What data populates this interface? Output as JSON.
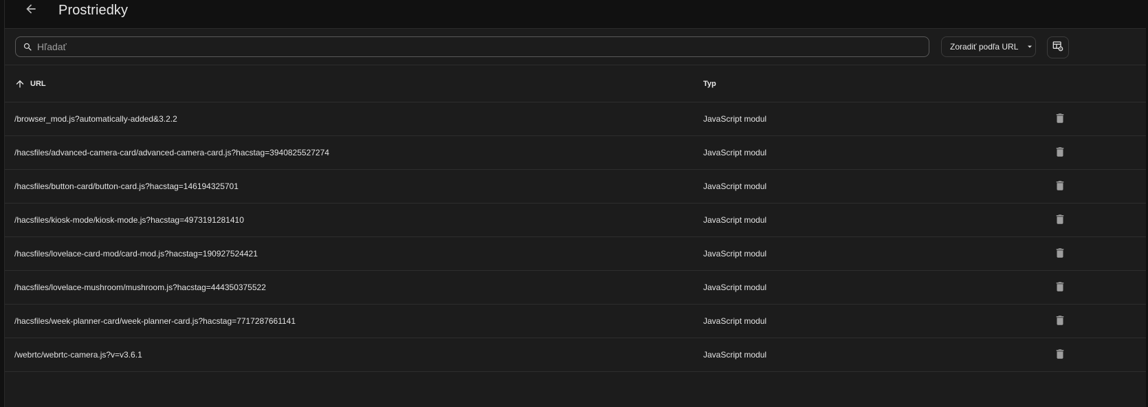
{
  "toolbar": {
    "title": "Prostriedky",
    "back_icon": "arrow-left-icon"
  },
  "search": {
    "placeholder": "Hľadať",
    "value": "",
    "icon": "search-icon"
  },
  "sort": {
    "label": "Zoradiť podľa URL",
    "icon": "caret-down-icon"
  },
  "settings": {
    "icon": "table-settings-icon"
  },
  "table": {
    "columns": {
      "url": "URL",
      "type": "Typ",
      "sort_icon": "arrow-up-icon"
    },
    "rows": [
      {
        "url": "/browser_mod.js?automatically-added&3.2.2",
        "type": "JavaScript modul"
      },
      {
        "url": "/hacsfiles/advanced-camera-card/advanced-camera-card.js?hacstag=3940825527274",
        "type": "JavaScript modul"
      },
      {
        "url": "/hacsfiles/button-card/button-card.js?hacstag=146194325701",
        "type": "JavaScript modul"
      },
      {
        "url": "/hacsfiles/kiosk-mode/kiosk-mode.js?hacstag=4973191281410",
        "type": "JavaScript modul"
      },
      {
        "url": "/hacsfiles/lovelace-card-mod/card-mod.js?hacstag=190927524421",
        "type": "JavaScript modul"
      },
      {
        "url": "/hacsfiles/lovelace-mushroom/mushroom.js?hacstag=444350375522",
        "type": "JavaScript modul"
      },
      {
        "url": "/hacsfiles/week-planner-card/week-planner-card.js?hacstag=7717287661141",
        "type": "JavaScript modul"
      },
      {
        "url": "/webrtc/webrtc-camera.js?v=v3.6.1",
        "type": "JavaScript modul"
      }
    ],
    "delete_icon": "trash-icon"
  },
  "colors": {
    "background": "#111111",
    "panel": "#1c1c1c",
    "text": "#e1e1e1",
    "icon": "#9e9e9e",
    "border": "#2e2e2e"
  }
}
